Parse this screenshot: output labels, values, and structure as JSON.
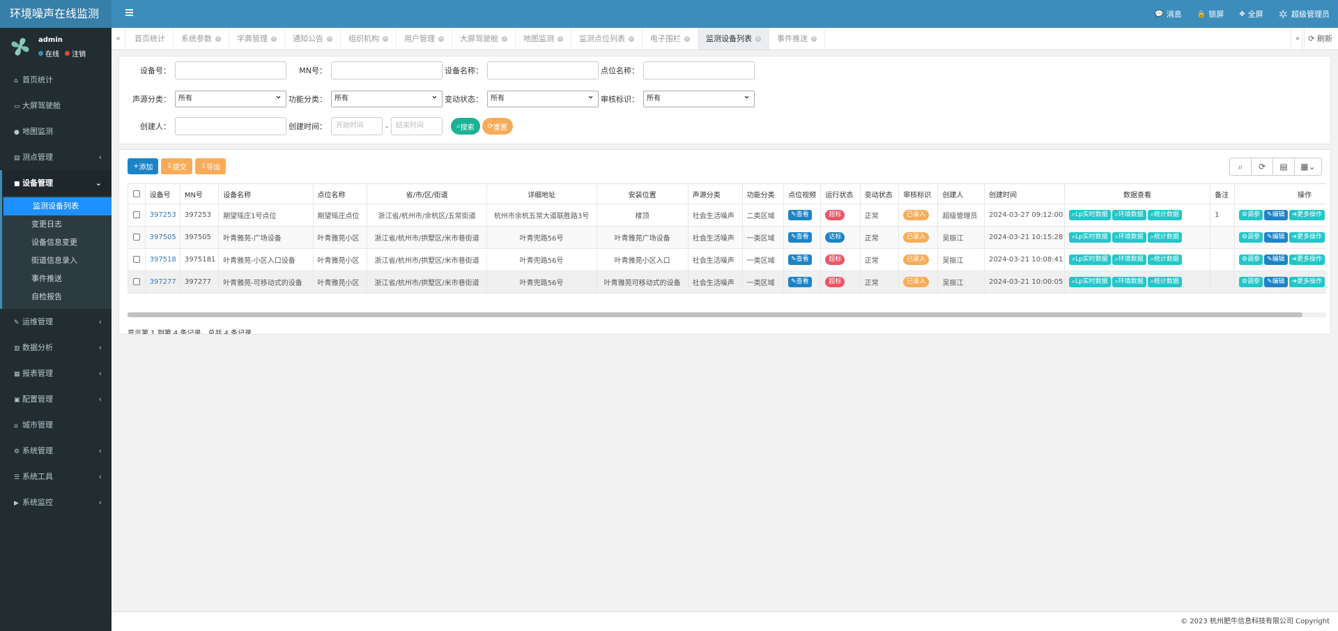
{
  "app": {
    "title": "环境噪声在线监测"
  },
  "topnav": {
    "messages": "消息",
    "lock": "锁屏",
    "fullscreen": "全屏",
    "user": "超级管理员"
  },
  "user": {
    "name": "admin",
    "online": "在线",
    "logout": "注销"
  },
  "sidebar": {
    "items": [
      {
        "label": "首页统计",
        "icon": "home-icon"
      },
      {
        "label": "大屏驾驶舱",
        "icon": "monitor-icon"
      },
      {
        "label": "地图监测",
        "icon": "globe-icon"
      },
      {
        "label": "测点管理",
        "icon": "id-card-icon"
      },
      {
        "label": "设备管理",
        "icon": "briefcase-icon"
      },
      {
        "label": "运维管理",
        "icon": "wrench-icon"
      },
      {
        "label": "数据分析",
        "icon": "bar-chart-icon"
      },
      {
        "label": "报表管理",
        "icon": "area-chart-icon"
      },
      {
        "label": "配置管理",
        "icon": "lock-icon"
      },
      {
        "label": "城市管理",
        "icon": "bank-icon"
      },
      {
        "label": "系统管理",
        "icon": "gear-icon"
      },
      {
        "label": "系统工具",
        "icon": "list-icon"
      },
      {
        "label": "系统监控",
        "icon": "video-icon"
      }
    ],
    "sub": [
      "监测设备列表",
      "变更日志",
      "设备信息变更",
      "街道信息录入",
      "事件推送",
      "自检报告"
    ]
  },
  "tabs": [
    "首页统计",
    "系统参数",
    "字典管理",
    "通知公告",
    "组织机构",
    "用户管理",
    "大屏驾驶舱",
    "地图监测",
    "监测点位列表",
    "电子围栏",
    "监测设备列表",
    "事件推送"
  ],
  "refresh_label": "刷新",
  "search": {
    "device_no_label": "设备号：",
    "mn_label": "MN号：",
    "device_name_label": "设备名称：",
    "point_name_label": "点位名称：",
    "source_label": "声源分类：",
    "function_label": "功能分类：",
    "change_label": "变动状态：",
    "audit_label": "审核标识：",
    "all_option": "所有",
    "creator_label": "创建人：",
    "time_label": "创建时间：",
    "start_placeholder": "开始时间",
    "end_placeholder": "结束时间",
    "dash": "-",
    "search_btn": "搜索",
    "reset_btn": "重置"
  },
  "toolbar": {
    "add": "添加",
    "submit": "提交",
    "export": "导出"
  },
  "table": {
    "headers": [
      "设备号",
      "MN号",
      "设备名称",
      "点位名称",
      "省/市/区/街道",
      "详细地址",
      "安装位置",
      "声源分类",
      "功能分类",
      "点位视频",
      "运行状态",
      "变动状态",
      "审核标识",
      "创建人",
      "创建时间",
      "数据查看",
      "备注",
      "操作"
    ],
    "rows": [
      {
        "id": "397253",
        "mn": "397253",
        "name": "期望瑶庄1号点位",
        "point": "期望瑶庄点位",
        "region": "浙江省/杭州市/余杭区/五常街道",
        "address": "杭州市余杭五常大道联胜路3号",
        "install": "楼顶",
        "source": "社会生活噪声",
        "func": "二类区域",
        "video": "查看",
        "run": "超标",
        "change": "正常",
        "audit": "已录入",
        "creator": "超级管理员",
        "time": "2024-03-27 09:12:00",
        "remark": "1"
      },
      {
        "id": "397505",
        "mn": "397505",
        "name": "叶青雅苑-广场设备",
        "point": "叶青雅苑小区",
        "region": "浙江省/杭州市/拱墅区/米市巷街道",
        "address": "叶青兜路56号",
        "install": "叶青雅苑广场设备",
        "source": "社会生活噪声",
        "func": "一类区域",
        "video": "查看",
        "run": "达标",
        "change": "正常",
        "audit": "已录入",
        "creator": "吴振江",
        "time": "2024-03-21 10:15:28",
        "remark": ""
      },
      {
        "id": "397518",
        "mn": "3975181",
        "name": "叶青雅苑-小区入口设备",
        "point": "叶青雅苑小区",
        "region": "浙江省/杭州市/拱墅区/米市巷街道",
        "address": "叶青兜路56号",
        "install": "叶青雅苑小区入口",
        "source": "社会生活噪声",
        "func": "一类区域",
        "video": "查看",
        "run": "超标",
        "change": "正常",
        "audit": "已录入",
        "creator": "吴振江",
        "time": "2024-03-21 10:08:41",
        "remark": ""
      },
      {
        "id": "397277",
        "mn": "397277",
        "name": "叶青雅苑-可移动式的设备",
        "point": "叶青雅苑小区",
        "region": "浙江省/杭州市/拱墅区/米市巷街道",
        "address": "叶青兜路56号",
        "install": "叶青雅苑可移动式的设备",
        "source": "社会生活噪声",
        "func": "一类区域",
        "video": "查看",
        "run": "超标",
        "change": "正常",
        "audit": "已录入",
        "creator": "吴振江",
        "time": "2024-03-21 10:00:05",
        "remark": ""
      }
    ],
    "data_buttons": [
      "Lp实时数据",
      "环境数据",
      "统计数据"
    ],
    "op_buttons": [
      "调参",
      "编辑",
      "更多操作"
    ]
  },
  "pageinfo": "显示第 1 到第 4 条记录，总共 4 条记录",
  "footer": "© 2023 杭州肥牛信息科技有限公司 Copyright",
  "colors": {
    "header": "#3c8dbc",
    "sidebar": "#222d32",
    "active": "#1e90ff",
    "cyan": "#23c6c8",
    "blue": "#1c84c6",
    "red": "#ed5565",
    "orange": "#f8ac59",
    "green": "#1ab394"
  }
}
